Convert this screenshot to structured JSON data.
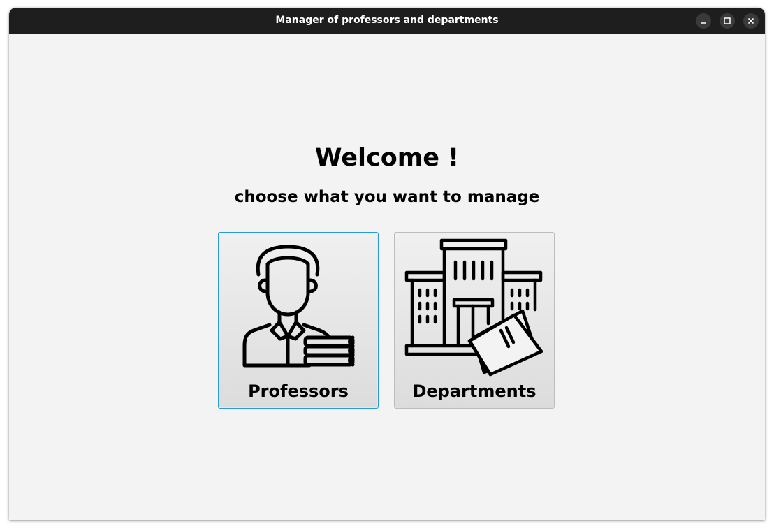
{
  "window": {
    "title": "Manager of professors and departments",
    "controls": [
      "minimize-icon",
      "maximize-icon",
      "close-icon"
    ]
  },
  "main": {
    "heading": "Welcome !",
    "subheading": "choose what you want to manage",
    "options": [
      {
        "label": "Professors",
        "icon": "professor-icon",
        "focused": true
      },
      {
        "label": "Departments",
        "icon": "building-icon",
        "focused": false
      }
    ]
  },
  "colors": {
    "titlebar": "#1e1e1e",
    "background": "#f3f3f3",
    "focus_border": "#2b9bd3"
  }
}
